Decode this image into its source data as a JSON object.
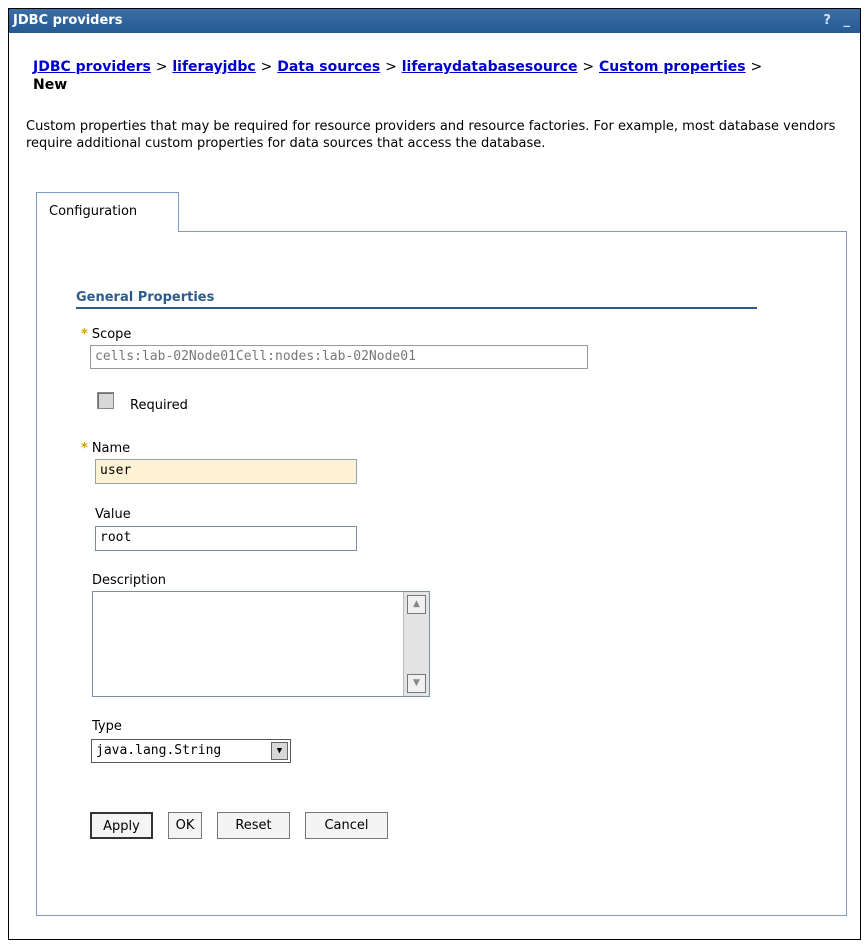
{
  "window": {
    "title": "JDBC providers",
    "controls": "? _"
  },
  "breadcrumb": {
    "items": [
      {
        "label": "JDBC providers"
      },
      {
        "label": "liferayjdbc"
      },
      {
        "label": "Data sources"
      },
      {
        "label": "liferaydatabasesource"
      },
      {
        "label": "Custom properties"
      }
    ],
    "current": "New",
    "separator": ">"
  },
  "description": "Custom properties that may be required for resource providers and resource factories. For example, most database vendors require additional custom properties for data sources that access the database.",
  "tabs": [
    {
      "label": "Configuration"
    }
  ],
  "general_properties": {
    "title": "General Properties",
    "required_marker": "*",
    "scope": {
      "label": "Scope",
      "value": "cells:lab-02Node01Cell:nodes:lab-02Node01"
    },
    "required": {
      "label": "Required",
      "checked": false
    },
    "name": {
      "label": "Name",
      "value": "user"
    },
    "value": {
      "label": "Value",
      "value": "root"
    },
    "description": {
      "label": "Description",
      "value": ""
    },
    "type": {
      "label": "Type",
      "selected": "java.lang.String"
    }
  },
  "buttons": {
    "apply": "Apply",
    "ok": "OK",
    "reset": "Reset",
    "cancel": "Cancel"
  },
  "colors": {
    "title_bar": "#255a93",
    "link": "#0000cc",
    "section_title": "#2d5b8c",
    "highlight_field": "#fdf2d4"
  }
}
